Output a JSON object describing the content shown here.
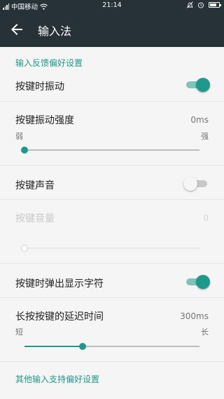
{
  "status_bar": {
    "carrier": "中国移动",
    "time": "21:14",
    "icons": [
      "signal-icon",
      "wifi-icon",
      "mute-icon",
      "alarm-icon",
      "battery-icon"
    ]
  },
  "toolbar": {
    "back_icon": "arrow-left-icon",
    "title": "输入法"
  },
  "sections": [
    {
      "header": "输入反馈偏好设置",
      "items": [
        {
          "type": "switch",
          "label": "按键时振动",
          "checked": true
        },
        {
          "type": "slider",
          "label": "按键振动强度",
          "value": "0ms",
          "min_label": "弱",
          "max_label": "强",
          "position": 0.0
        },
        {
          "type": "switch",
          "label": "按键声音",
          "checked": false
        },
        {
          "type": "slider",
          "label": "按键音量",
          "value": "0",
          "enabled": false,
          "position": 0.0
        },
        {
          "type": "switch",
          "label": "按键时弹出显示字符",
          "checked": true
        },
        {
          "type": "slider",
          "label": "长按按键的延迟时间",
          "value": "300ms",
          "min_label": "短",
          "max_label": "长",
          "position": 0.33
        }
      ]
    },
    {
      "header": "其他输入支持偏好设置"
    }
  ],
  "colors": {
    "accent": "#1e9a8c",
    "toolbar": "#263238",
    "background": "#f5f5f5"
  }
}
